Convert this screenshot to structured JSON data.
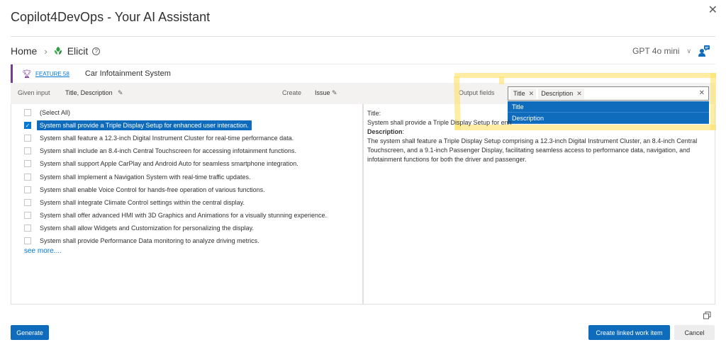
{
  "app": {
    "title": "Copilot4DevOps - Your AI Assistant"
  },
  "breadcrumb": {
    "home": "Home",
    "current": "Elicit"
  },
  "model_selector": {
    "value": "GPT 4o mini"
  },
  "feature": {
    "link": "FEATURE 58",
    "title": "Car Infotainment System"
  },
  "options": {
    "given_input_label": "Given input",
    "given_input_value": "Title, Description",
    "create_label": "Create",
    "create_value": "Issue",
    "output_fields_label": "Output fields",
    "output_chips": [
      "Title",
      "Description"
    ],
    "dropdown_options": [
      "Title",
      "Description"
    ]
  },
  "requirements": {
    "select_all": "(Select All)",
    "items": [
      "System shall provide a Triple Display Setup for enhanced user interaction.",
      "System shall feature a 12.3-inch Digital Instrument Cluster for real-time performance data.",
      "System shall include an 8.4-inch Central Touchscreen for accessing infotainment functions.",
      "System shall support Apple CarPlay and Android Auto for seamless smartphone integration.",
      "System shall implement a Navigation System with real-time traffic updates.",
      "System shall enable Voice Control for hands-free operation of various functions.",
      "System shall integrate Climate Control settings within the central display.",
      "System shall offer advanced HMI with 3D Graphics and Animations for a visually stunning experience.",
      "System shall allow Widgets and Customization for personalizing the display.",
      "System shall provide Performance Data monitoring to analyze driving metrics."
    ],
    "see_more": "see more...."
  },
  "detail": {
    "title_label": "Title",
    "title_value": "System shall provide a Triple Display Setup for enh",
    "description_label": "Description",
    "description_value": "The system shall feature a Triple Display Setup comprising a 12.3-inch Digital Instrument Cluster, an 8.4-inch Central Touchscreen, and a 9.1-inch Passenger Display, facilitating seamless access to performance data, navigation, and infotainment functions for both the driver and passenger."
  },
  "buttons": {
    "generate": "Generate",
    "create_linked": "Create linked work item",
    "cancel": "Cancel"
  },
  "colors": {
    "accent": "#0f6cbd",
    "feature": "#773b93",
    "highlight": "#fde269"
  }
}
